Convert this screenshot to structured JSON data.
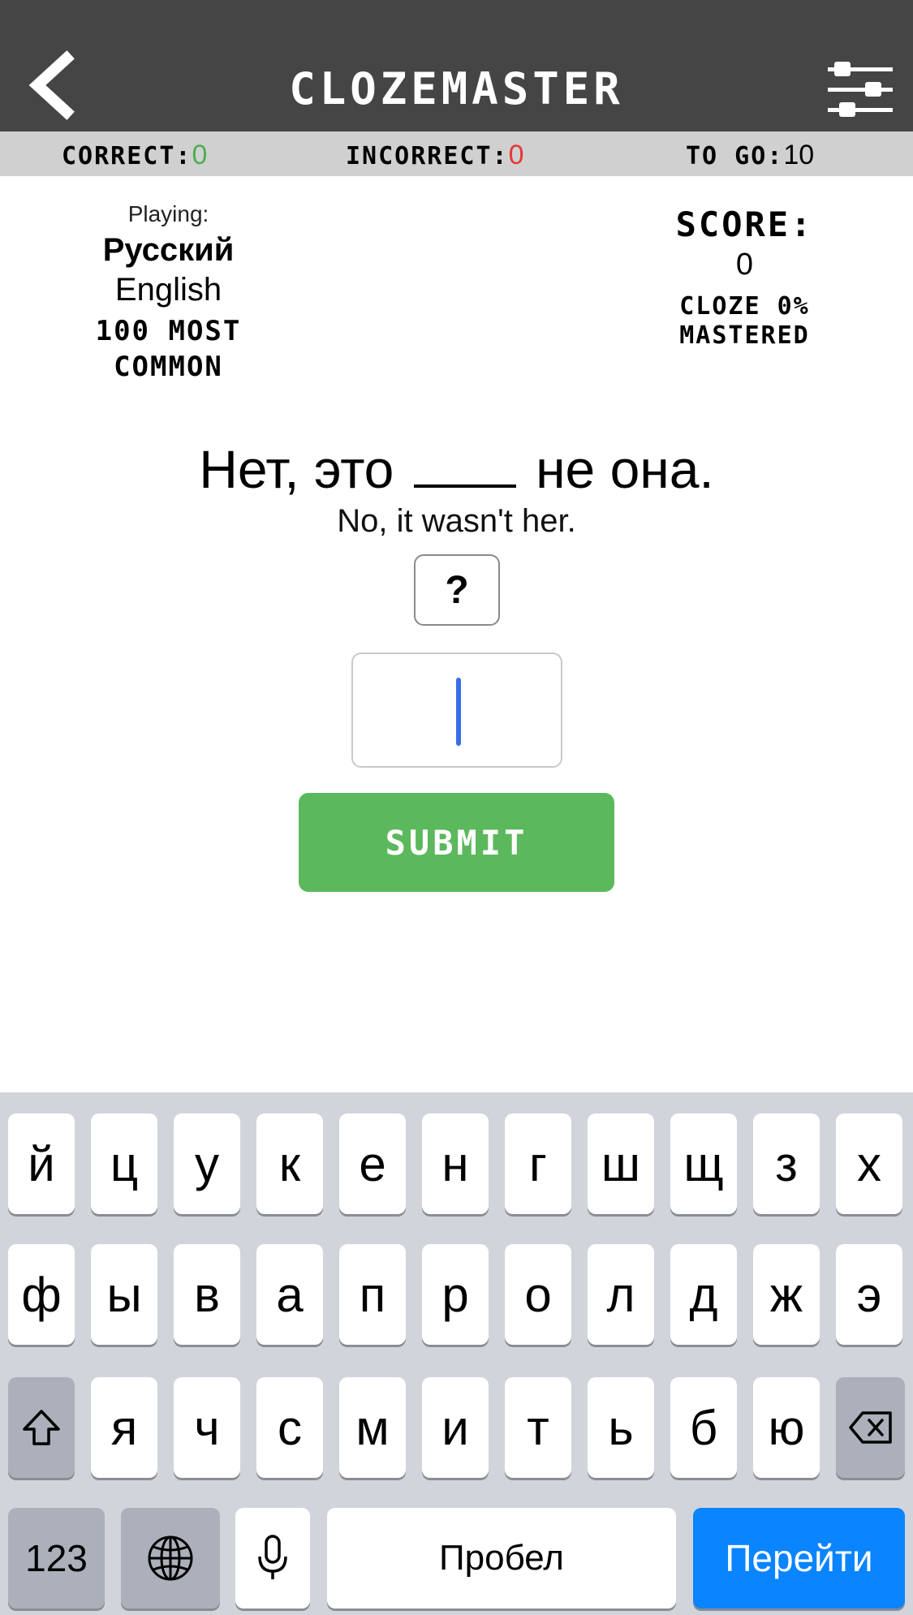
{
  "header": {
    "title": "CLOZEMASTER"
  },
  "stats": {
    "correct_label": "CORRECT:",
    "correct_value": "0",
    "incorrect_label": "INCORRECT:",
    "incorrect_value": "0",
    "togo_label": "TO GO:",
    "togo_value": "10"
  },
  "playing": {
    "label": "Playing:",
    "primary_language": "Русский",
    "secondary_language": "English",
    "collection_line1": "100 MOST",
    "collection_line2": "COMMON"
  },
  "score": {
    "label": "SCORE:",
    "value": "0",
    "mastered_line1": "CLOZE 0%",
    "mastered_line2": "MASTERED"
  },
  "sentence": {
    "before": "Нет, это",
    "after": "не она.",
    "translation": "No, it wasn't her."
  },
  "hint_label": "?",
  "answer_value": "",
  "submit_label": "SUBMIT",
  "keyboard": {
    "row1": [
      "й",
      "ц",
      "у",
      "к",
      "е",
      "н",
      "г",
      "ш",
      "щ",
      "з",
      "х"
    ],
    "row2": [
      "ф",
      "ы",
      "в",
      "а",
      "п",
      "р",
      "о",
      "л",
      "д",
      "ж",
      "э"
    ],
    "row3": [
      "я",
      "ч",
      "с",
      "м",
      "и",
      "т",
      "ь",
      "б",
      "ю"
    ],
    "numbers_label": "123",
    "space_label": "Пробел",
    "go_label": "Перейти"
  },
  "colors": {
    "header": "#454545",
    "correct": "#4caf50",
    "incorrect": "#e53935",
    "submit": "#5cb85c",
    "go_key": "#0a84ff",
    "caret": "#3a6ee8"
  },
  "icons": [
    "back-chevron-icon",
    "settings-sliders-icon",
    "shift-icon",
    "delete-icon",
    "globe-icon",
    "microphone-icon"
  ]
}
